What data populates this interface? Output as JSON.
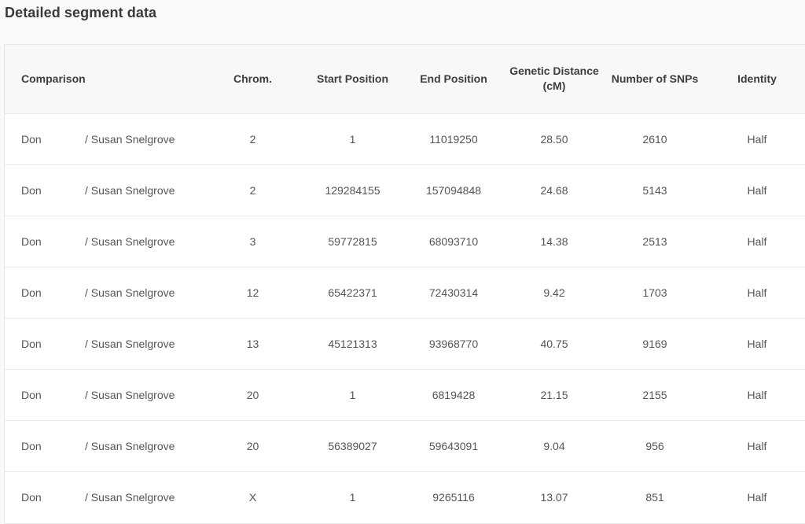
{
  "page": {
    "title": "Detailed segment data"
  },
  "table": {
    "headers": {
      "comparison": "Comparison",
      "chrom": "Chrom.",
      "start": "Start Position",
      "end": "End Position",
      "distance_line1": "Genetic Distance",
      "distance_line2": "(cM)",
      "snps": "Number of SNPs",
      "identity": "Identity"
    },
    "rows": [
      {
        "person_a": "Don",
        "person_b": "/ Susan Snelgrove",
        "chrom": "2",
        "start": "1",
        "end": "11019250",
        "distance": "28.50",
        "snps": "2610",
        "identity": "Half"
      },
      {
        "person_a": "Don",
        "person_b": "/ Susan Snelgrove",
        "chrom": "2",
        "start": "129284155",
        "end": "157094848",
        "distance": "24.68",
        "snps": "5143",
        "identity": "Half"
      },
      {
        "person_a": "Don",
        "person_b": "/ Susan Snelgrove",
        "chrom": "3",
        "start": "59772815",
        "end": "68093710",
        "distance": "14.38",
        "snps": "2513",
        "identity": "Half"
      },
      {
        "person_a": "Don",
        "person_b": "/ Susan Snelgrove",
        "chrom": "12",
        "start": "65422371",
        "end": "72430314",
        "distance": "9.42",
        "snps": "1703",
        "identity": "Half"
      },
      {
        "person_a": "Don",
        "person_b": "/ Susan Snelgrove",
        "chrom": "13",
        "start": "45121313",
        "end": "93968770",
        "distance": "40.75",
        "snps": "9169",
        "identity": "Half"
      },
      {
        "person_a": "Don",
        "person_b": "/ Susan Snelgrove",
        "chrom": "20",
        "start": "1",
        "end": "6819428",
        "distance": "21.15",
        "snps": "2155",
        "identity": "Half"
      },
      {
        "person_a": "Don",
        "person_b": "/ Susan Snelgrove",
        "chrom": "20",
        "start": "56389027",
        "end": "59643091",
        "distance": "9.04",
        "snps": "956",
        "identity": "Half"
      },
      {
        "person_a": "Don",
        "person_b": "/ Susan Snelgrove",
        "chrom": "X",
        "start": "1",
        "end": "9265116",
        "distance": "13.07",
        "snps": "851",
        "identity": "Half"
      }
    ]
  }
}
